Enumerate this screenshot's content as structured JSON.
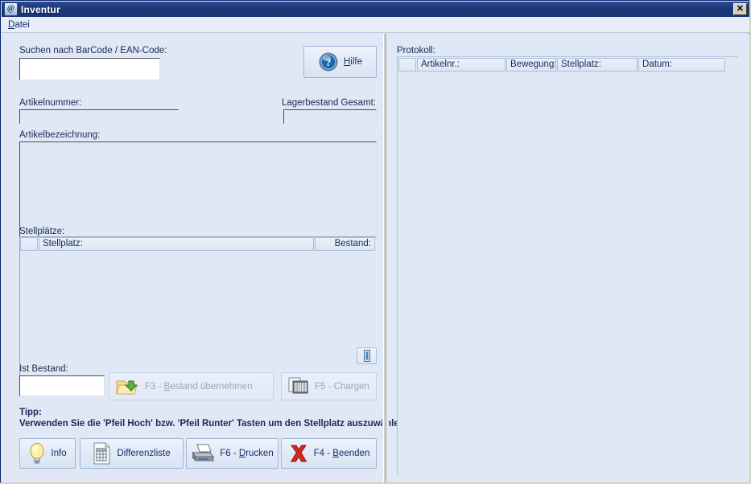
{
  "window": {
    "title": "Inventur",
    "title_icon": "at-sign-icon",
    "close_label": "✕",
    "frame_color": "#0a246a",
    "titlebar_color": "#1d3878",
    "background_color": "#dfe8f4"
  },
  "menubar": {
    "items": [
      {
        "label": "Datei",
        "accel": "D"
      }
    ]
  },
  "left_panel": {
    "barcode": {
      "label": "Suchen nach BarCode / EAN-Code:",
      "value": "",
      "placeholder": "",
      "enabled": true
    },
    "artikelnummer": {
      "label": "Artikelnummer:",
      "value": "",
      "placeholder": "",
      "enabled": false
    },
    "lagerbestand": {
      "label": "Lagerbestand Gesamt:",
      "value": "",
      "placeholder": "",
      "enabled": false
    },
    "artikelbezeichnung": {
      "label": "Artikelbezeichnung:",
      "value": "",
      "placeholder": "",
      "enabled": false
    },
    "help_button": {
      "label": "Hilfe",
      "accel": "H",
      "icon": "help-question-icon"
    },
    "stellplaetze": {
      "label": "Stellplätze:",
      "columns": [
        "",
        "Stellplatz:",
        "Bestand:"
      ],
      "rows": []
    },
    "stellplatz_tool_button": {
      "icon": "measure-column-icon",
      "label": ""
    },
    "ist_bestand": {
      "label": "Ist Bestand:",
      "value": "",
      "placeholder": "",
      "enabled": true
    },
    "action_buttons": [
      {
        "label": "F3 - Bestand übernehmen",
        "accel": "B",
        "icon": "folder-import-icon",
        "enabled": false
      },
      {
        "label": "F5 - Chargen",
        "accel": "",
        "icon": "barcode-box-icon",
        "enabled": false
      }
    ],
    "tip": {
      "title": "Tipp:",
      "text": "Verwenden Sie die 'Pfeil Hoch' bzw. 'Pfeil Runter' Tasten um den Stellplatz auszuwählen!"
    },
    "footer_buttons": [
      {
        "label": "Info",
        "accel": "",
        "icon": "lightbulb-icon",
        "enabled": true
      },
      {
        "label": "Differenzliste",
        "accel": "",
        "icon": "document-table-icon",
        "enabled": true
      },
      {
        "label": "F6 - Drucken",
        "accel": "D",
        "icon": "printer-icon",
        "enabled": true
      },
      {
        "label": "F4 - Beenden",
        "accel": "B",
        "icon": "red-x-icon",
        "enabled": true
      }
    ]
  },
  "right_panel": {
    "protokoll": {
      "label": "Protokoll:",
      "columns": [
        "",
        "Artikelnr.:",
        "Bewegung:",
        "Stellplatz:",
        "Datum:"
      ],
      "rows": []
    }
  }
}
